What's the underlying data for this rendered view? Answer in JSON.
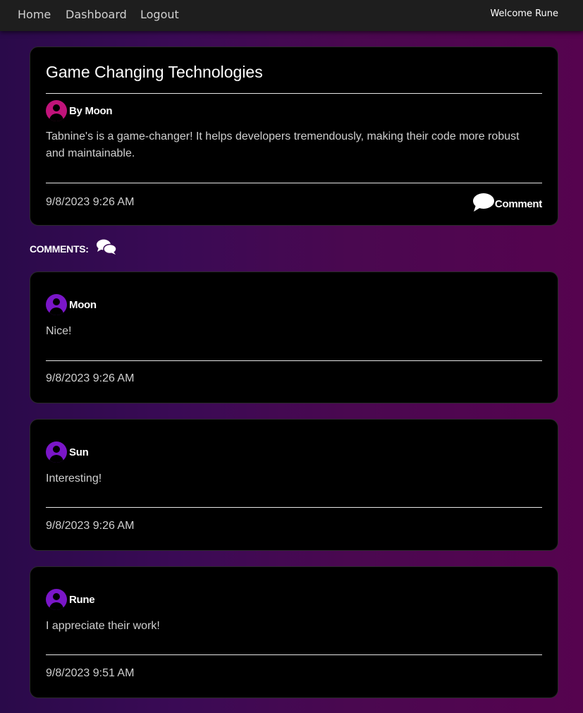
{
  "nav": {
    "home": "Home",
    "dashboard": "Dashboard",
    "logout": "Logout",
    "welcome": "Welcome Rune"
  },
  "post": {
    "title": "Game Changing Technologies",
    "author": "By Moon",
    "body": "Tabnine's is a game-changer! It helps developers tremendously, making their code more robust and maintainable.",
    "timestamp": "9/8/2023 9:26 AM",
    "comment_button": "Comment",
    "avatar_color": "#c0137a"
  },
  "comments_section": {
    "label": "COMMENTS:"
  },
  "comments": [
    {
      "author": "Moon",
      "text": "Nice!",
      "timestamp": "9/8/2023 9:26 AM"
    },
    {
      "author": "Sun",
      "text": "Interesting!",
      "timestamp": "9/8/2023 9:26 AM"
    },
    {
      "author": "Rune",
      "text": "I appreciate their work!",
      "timestamp": "9/8/2023 9:51 AM"
    }
  ],
  "colors": {
    "comment_avatar": "#7a16c8",
    "card_bg": "#000000",
    "nav_bg": "#1e1e1e"
  }
}
